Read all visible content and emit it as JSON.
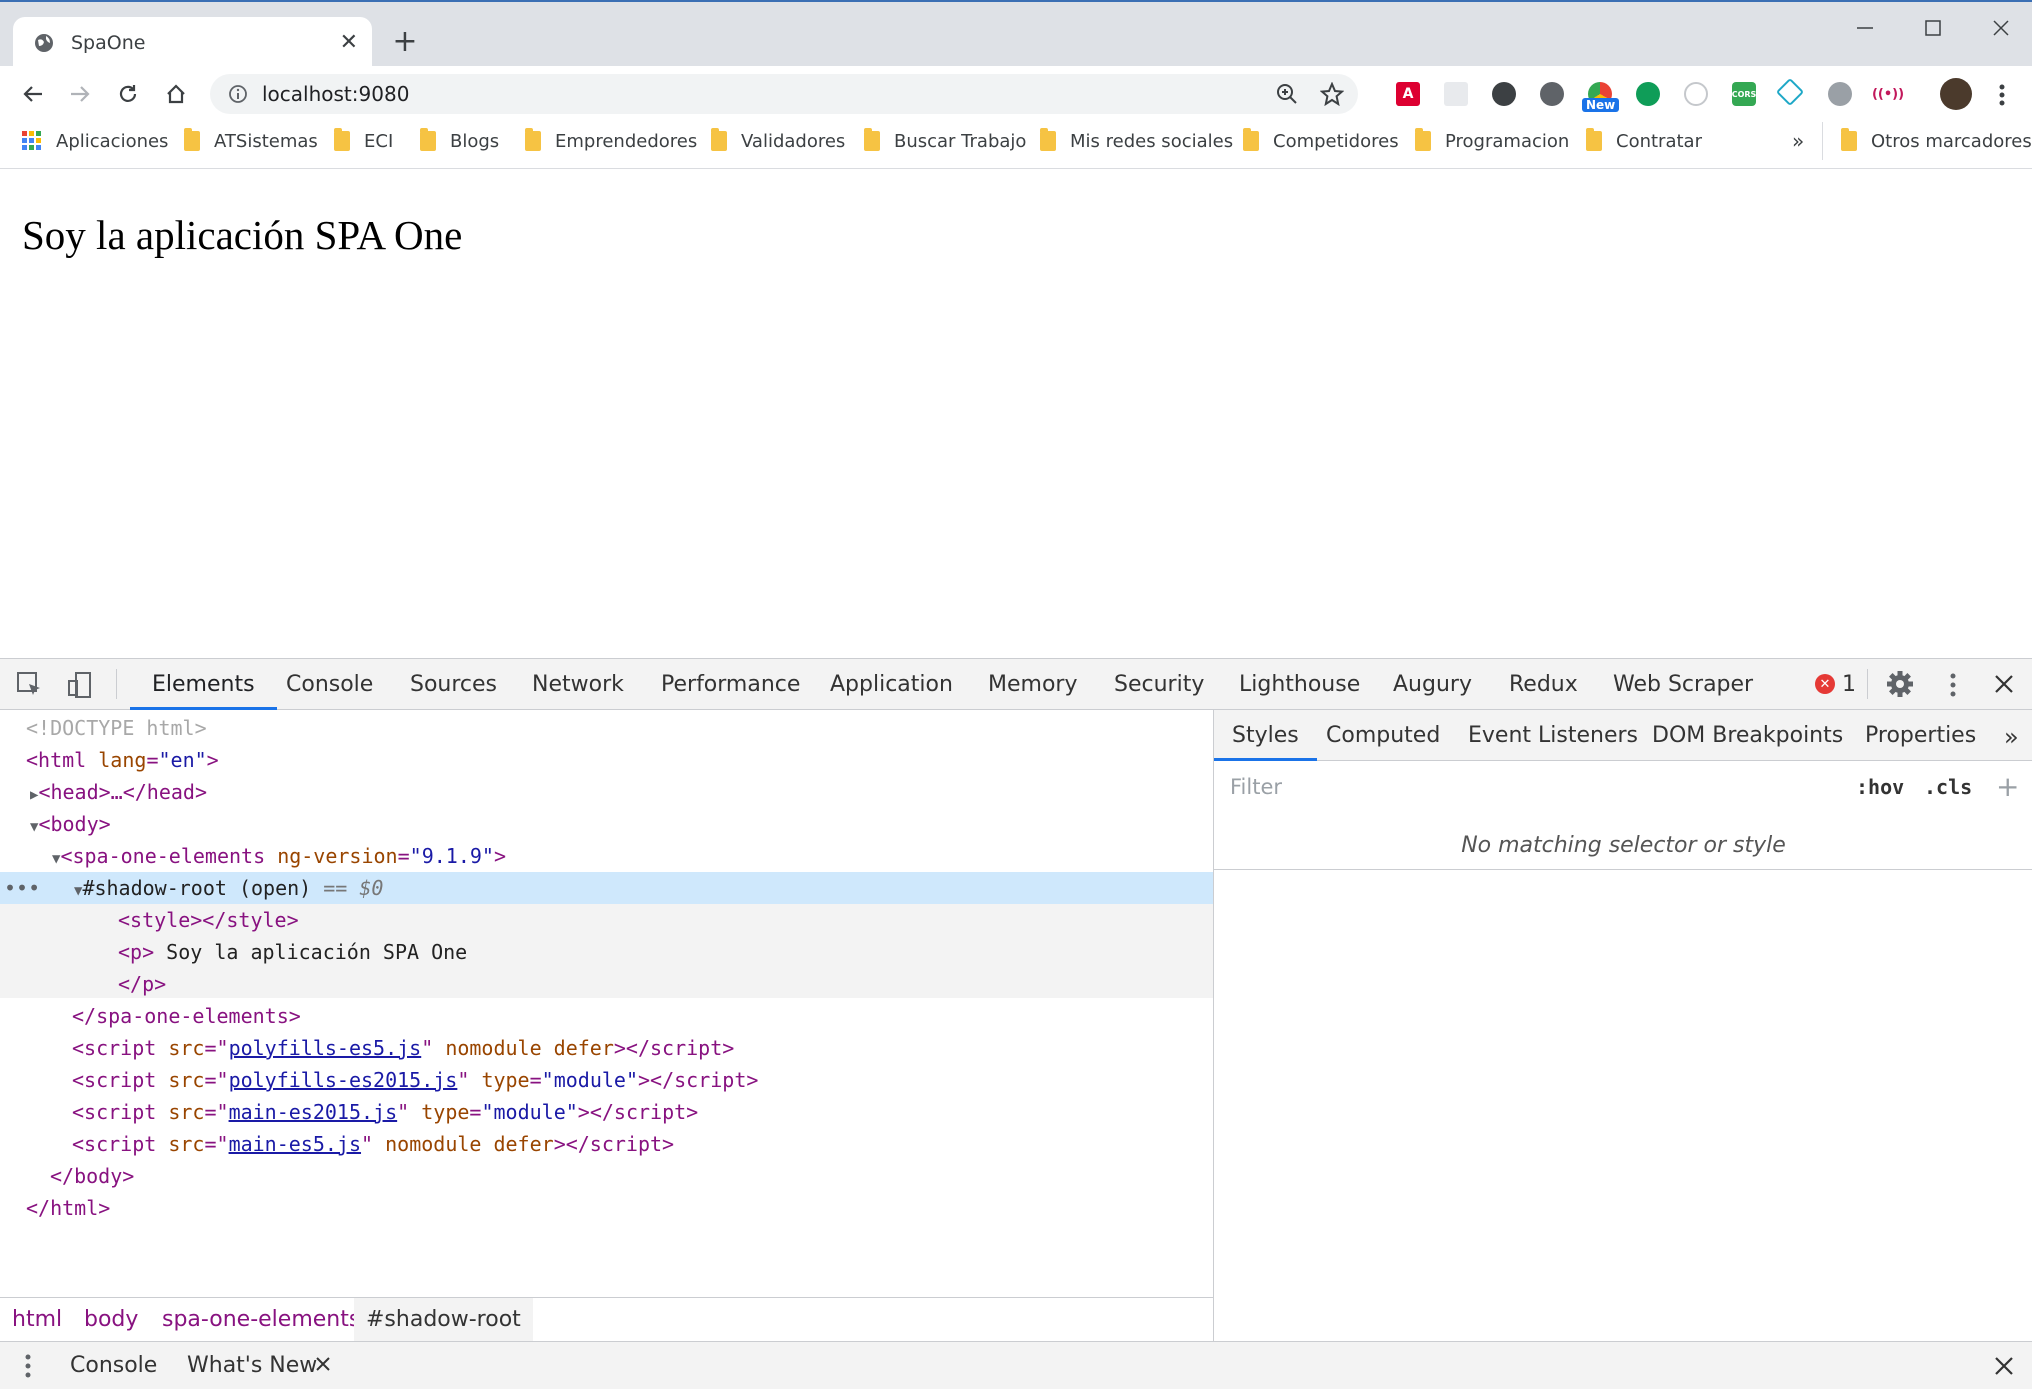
{
  "browser": {
    "tab_title": "SpaOne",
    "url": "localhost:9080",
    "extension_badge": "New",
    "bookmarks": [
      "Aplicaciones",
      "ATSistemas",
      "ECI",
      "Blogs",
      "Emprendedores",
      "Validadores",
      "Buscar Trabajo",
      "Mis redes sociales",
      "Competidores",
      "Programacion",
      "Contratar"
    ],
    "bookmarks_more": "»",
    "other_bookmarks": "Otros marcadores"
  },
  "page": {
    "text": "Soy la aplicación SPA One"
  },
  "devtools": {
    "tabs": [
      "Elements",
      "Console",
      "Sources",
      "Network",
      "Performance",
      "Application",
      "Memory",
      "Security",
      "Lighthouse",
      "Augury",
      "Redux",
      "Web Scraper"
    ],
    "error_count": "1",
    "elements": {
      "doctype": "<!DOCTYPE html>",
      "html_open": "<html",
      "lang_attr": "lang",
      "lang_val": "\"en\"",
      "head": "<head>…</head>",
      "body_open": "<body>",
      "spa_open": "<spa-one-elements",
      "ng_attr": "ng-version",
      "ng_val": "\"9.1.9\"",
      "shadow": "#shadow-root (open)",
      "shadow_eq": "== $0",
      "style": "<style></style>",
      "p_open": "<p>",
      "p_text": "Soy la aplicación SPA One",
      "p_close": "</p>",
      "spa_close": "</spa-one-elements>",
      "scripts": [
        {
          "src": "polyfills-es5.js",
          "extra_attr": "nomodule defer",
          "type": ""
        },
        {
          "src": "polyfills-es2015.js",
          "extra_attr": "",
          "type": "\"module\""
        },
        {
          "src": "main-es2015.js",
          "extra_attr": "",
          "type": "\"module\""
        },
        {
          "src": "main-es5.js",
          "extra_attr": "nomodule defer",
          "type": ""
        }
      ],
      "body_close": "</body>",
      "html_close": "</html>"
    },
    "breadcrumbs": [
      "html",
      "body",
      "spa-one-elements",
      "#shadow-root"
    ],
    "styles_tabs": [
      "Styles",
      "Computed",
      "Event Listeners",
      "DOM Breakpoints",
      "Properties"
    ],
    "filter_placeholder": "Filter",
    "hov": ":hov",
    "cls": ".cls",
    "no_match": "No matching selector or style",
    "drawer_tabs": [
      "Console",
      "What's New"
    ]
  },
  "colors": {
    "accent": "#1a73e8",
    "tag": "#881280",
    "attr_name": "#994500",
    "attr_value": "#1a1aa6",
    "error": "#e53935"
  }
}
